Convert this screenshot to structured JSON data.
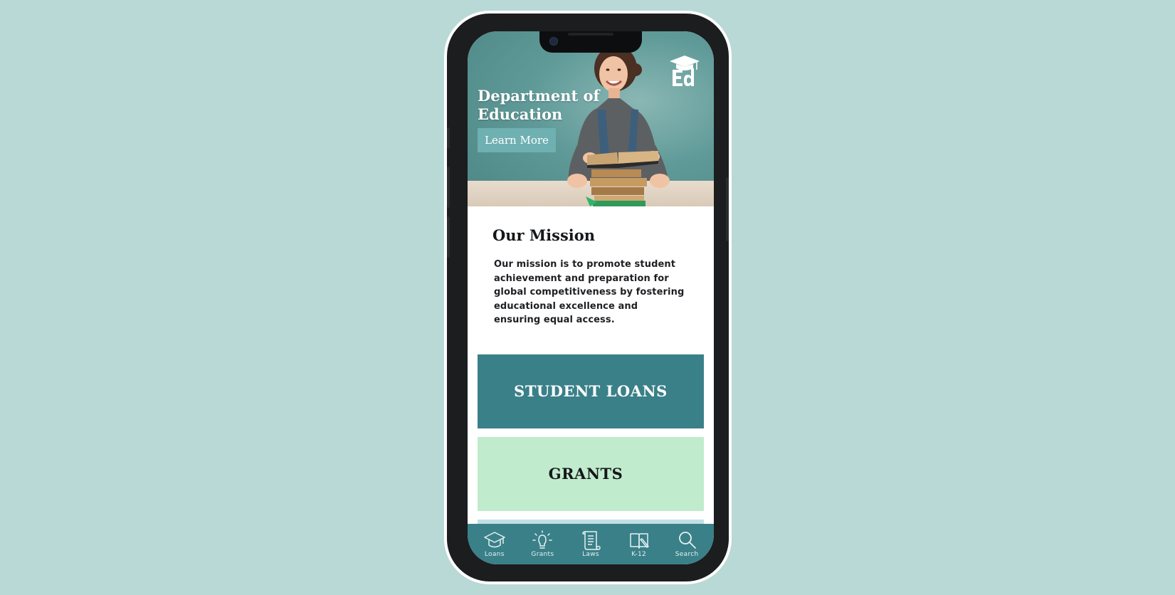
{
  "hero": {
    "title_line1": "Department of",
    "title_line2": "Education",
    "cta_label": "Learn More",
    "logo_icon": "graduation-cap-ed-logo"
  },
  "mission": {
    "title": "Our Mission",
    "text": "Our mission is to promote student achievement and preparation for global competitiveness by fostering educational excellence and ensuring equal access."
  },
  "cards": {
    "loans_label": "STUDENT LOANS",
    "grants_label": "GRANTS"
  },
  "nav": {
    "items": [
      {
        "label": "Loans",
        "icon": "graduation-cap-icon"
      },
      {
        "label": "Grants",
        "icon": "lightbulb-icon"
      },
      {
        "label": "Laws",
        "icon": "scroll-icon"
      },
      {
        "label": "K-12",
        "icon": "book-pencil-icon"
      },
      {
        "label": "Search",
        "icon": "search-icon"
      }
    ]
  },
  "colors": {
    "background": "#b9d9d6",
    "teal": "#3a8089",
    "mint": "#c1ebcd",
    "light_blue": "#bfe0e6",
    "button": "#6fb0b2"
  }
}
